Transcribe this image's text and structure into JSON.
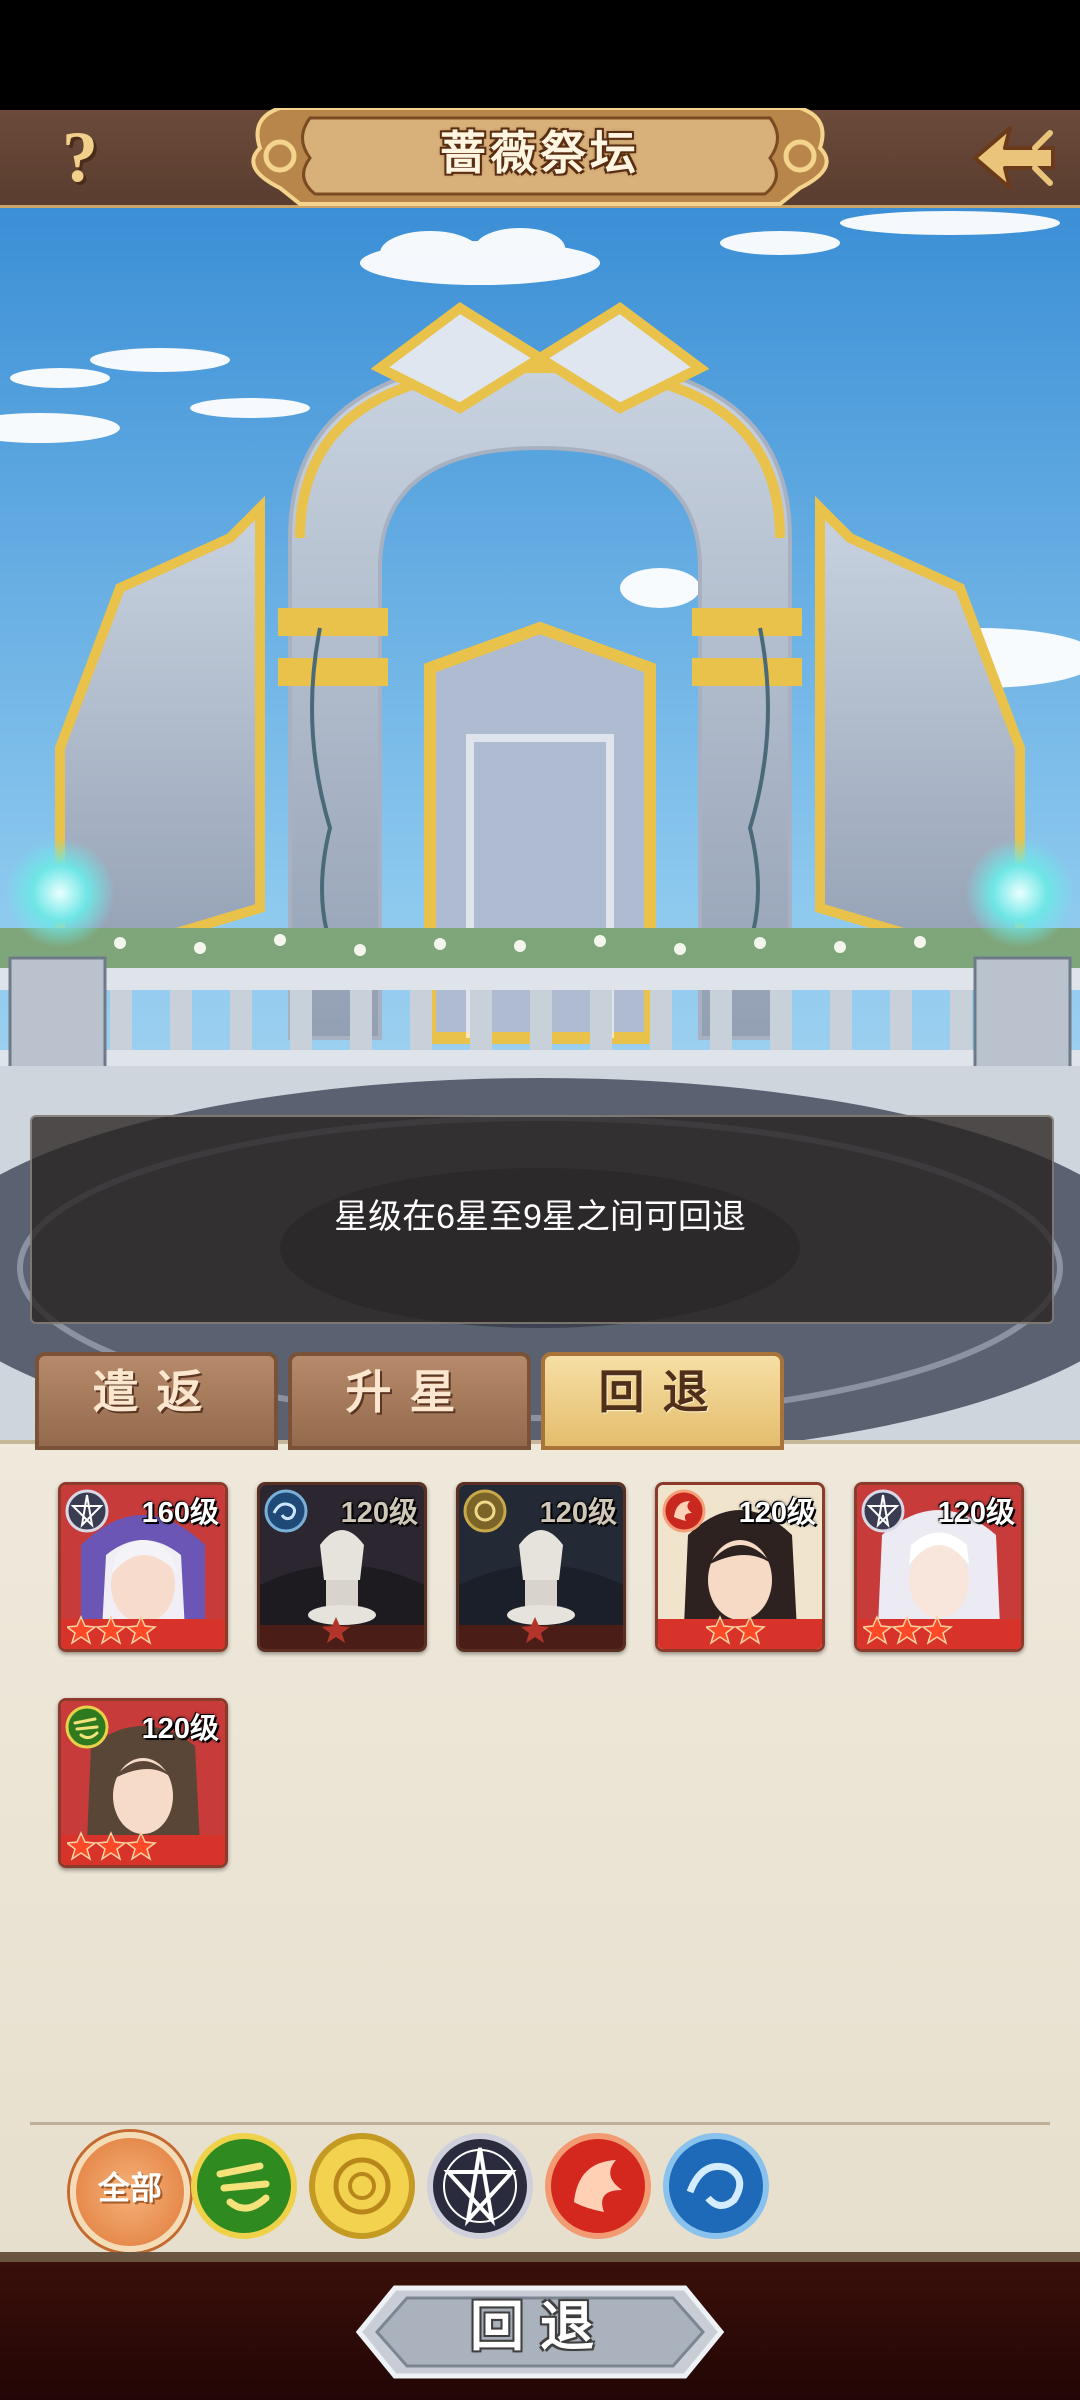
{
  "header": {
    "title": "蔷薇祭坛",
    "help_label": "?",
    "help_icon": "question-mark-icon",
    "back_icon": "back-arrow-icon"
  },
  "info": {
    "message": "星级在6星至9星之间可回退"
  },
  "tabs": [
    {
      "label": "遣返",
      "active": false
    },
    {
      "label": "升星",
      "active": false
    },
    {
      "label": "回退",
      "active": true
    }
  ],
  "heroes": [
    {
      "level": "160级",
      "faction": "pentagram",
      "stars": 3,
      "dimmed": false,
      "portrait": "white-haired-woman-purple-hood"
    },
    {
      "level": "120级",
      "faction": "ocean",
      "stars": 1,
      "dimmed": true,
      "portrait": "statue-figure"
    },
    {
      "level": "120级",
      "faction": "rose",
      "stars": 1,
      "dimmed": true,
      "portrait": "statue-figure"
    },
    {
      "level": "120级",
      "faction": "phoenix",
      "stars": 2,
      "dimmed": false,
      "portrait": "dark-haired-woman"
    },
    {
      "level": "120级",
      "faction": "pentagram",
      "stars": 3,
      "dimmed": false,
      "portrait": "white-haired-man"
    },
    {
      "level": "120级",
      "faction": "dragon",
      "stars": 3,
      "dimmed": false,
      "portrait": "long-haired-man"
    }
  ],
  "filters": {
    "all_label": "全部",
    "items": [
      "all",
      "dragon",
      "rose",
      "pentagram",
      "phoenix",
      "ocean"
    ]
  },
  "footer": {
    "confirm_label": "回退"
  },
  "colors": {
    "header_bg": "#6b4a3a",
    "gold": "#e4bd6d",
    "panel_bg": "#efe9dc",
    "card_border": "#8c3a2a",
    "star_red": "#e33a26",
    "footer_bg": "#2a0807"
  }
}
